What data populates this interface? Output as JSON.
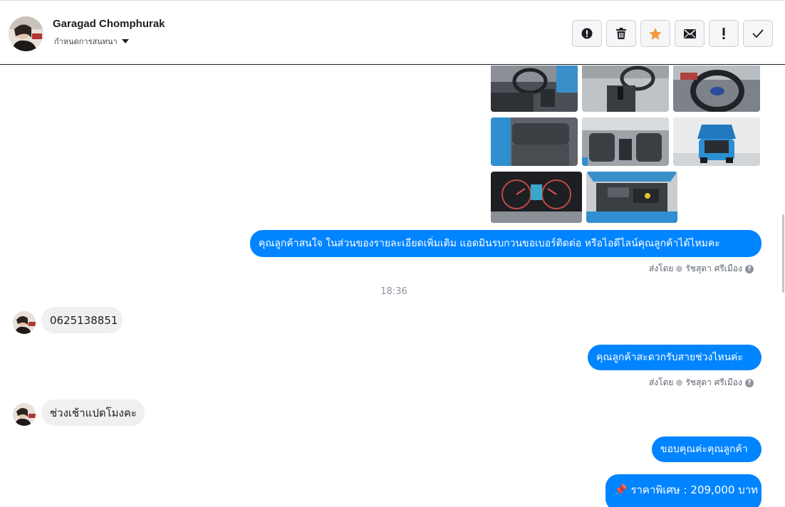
{
  "header": {
    "contact_name": "Garagad Chomphurak",
    "conversation_status": "กำหนดการสนทนา",
    "actions": [
      {
        "name": "mark-spam-button",
        "icon": "alert-circle-icon",
        "symbol": "!"
      },
      {
        "name": "delete-button",
        "icon": "trash-icon",
        "symbol": ""
      },
      {
        "name": "star-button",
        "icon": "star-icon",
        "symbol": "★"
      },
      {
        "name": "mark-unread-button",
        "icon": "envelope-icon",
        "symbol": ""
      },
      {
        "name": "important-button",
        "icon": "exclamation-icon",
        "symbol": "!"
      },
      {
        "name": "done-button",
        "icon": "checkmark-icon",
        "symbol": "✓"
      }
    ]
  },
  "thread": {
    "photos": [
      {
        "name": "car-photo-dashboard"
      },
      {
        "name": "car-photo-gear-shift"
      },
      {
        "name": "car-photo-steering-wheel"
      },
      {
        "name": "car-photo-rear-seats"
      },
      {
        "name": "car-photo-front-seats"
      },
      {
        "name": "car-photo-hatch-open"
      },
      {
        "name": "car-photo-instrument-cluster"
      },
      {
        "name": "car-photo-engine-bay"
      }
    ],
    "messages": {
      "out_1": "คุณลูกค้าสนใจ ในส่วนของรายละเอียดเพิ่มเติม แอดมินรบกวนขอเบอร์ติดต่อ หรือไอดีไลน์คุณลูกค้าได้ไหมคะ",
      "sent_by_1": "ส่งโดย",
      "agent_1": "รัชสุดา ศรีเมือง",
      "time": "18:36",
      "in_1": "0625138851",
      "out_2": "คุณลูกค้าสะดวกรับสายช่วงไหนค่ะ",
      "sent_by_2": "ส่งโดย",
      "agent_2": "รัชสุดา ศรีเมือง",
      "in_2": "ช่วงเช้าแปดโมงคะ",
      "out_3": "ขอบคุณค่ะคุณลูกค้า",
      "out_4": "📌 ราคาพิเศษ : 209,000 บาท"
    }
  },
  "colors": {
    "messenger_blue": "#0084ff",
    "incoming_bubble": "#f0f0f0",
    "star": "#f5993d"
  }
}
